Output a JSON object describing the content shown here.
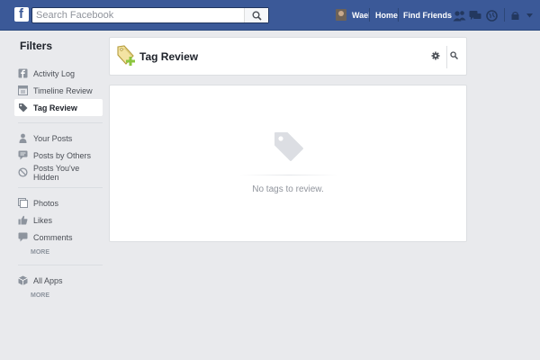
{
  "topbar": {
    "logo": "f",
    "search_placeholder": "Search Facebook",
    "user_name": "Wael",
    "home_label": "Home",
    "find_friends_label": "Find Friends",
    "icons": [
      "search-icon",
      "friend-requests-icon",
      "messages-icon",
      "notifications-icon",
      "privacy-shortcuts-icon",
      "chevron-down-icon"
    ]
  },
  "sidebar": {
    "title": "Filters",
    "group1": [
      {
        "label": "Activity Log",
        "icon": "facebook-icon"
      },
      {
        "label": "Timeline Review",
        "icon": "timeline-icon"
      },
      {
        "label": "Tag Review",
        "icon": "tag-icon",
        "active": true
      }
    ],
    "group2": [
      {
        "label": "Your Posts",
        "icon": "person-icon"
      },
      {
        "label": "Posts by Others",
        "icon": "speech-bubble-icon"
      },
      {
        "label": "Posts You've Hidden",
        "icon": "hidden-icon"
      }
    ],
    "group3": [
      {
        "label": "Photos",
        "icon": "photos-icon"
      },
      {
        "label": "Likes",
        "icon": "thumbs-up-icon"
      },
      {
        "label": "Comments",
        "icon": "comment-icon"
      }
    ],
    "group3_more": "MORE",
    "group4": [
      {
        "label": "All Apps",
        "icon": "apps-icon"
      }
    ],
    "group4_more": "MORE"
  },
  "header": {
    "title": "Tag Review",
    "icons": [
      "tag-plus-icon",
      "gear-icon",
      "search-icon"
    ]
  },
  "content": {
    "empty_message": "No tags to review.",
    "empty_icon": "tag-icon"
  },
  "colors": {
    "brand_blue": "#3b5998",
    "page_bg": "#e9eaed",
    "tag_accent": "#8cc63e"
  }
}
